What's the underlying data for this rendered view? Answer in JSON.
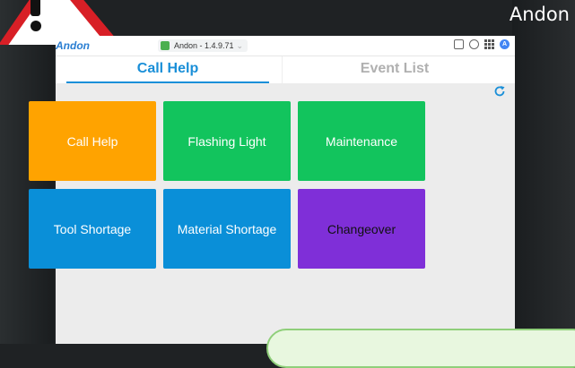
{
  "corner_title": "Andon",
  "app": {
    "brand": "Andon",
    "version_tab": "Andon - 1.4.9.71",
    "avatar_letter": "A"
  },
  "tabs": [
    {
      "label": "Call Help",
      "active": true
    },
    {
      "label": "Event List",
      "active": false
    }
  ],
  "tiles": [
    {
      "label": "Call Help",
      "color": "#ffa300"
    },
    {
      "label": "Flashing Light",
      "color": "#12c45d"
    },
    {
      "label": "Maintenance",
      "color": "#12c45d"
    },
    {
      "label": "Tool Shortage",
      "color": "#0a8fd8"
    },
    {
      "label": "Material Shortage",
      "color": "#0a8fd8"
    },
    {
      "label": "Changeover",
      "color": "#7f2fd8"
    }
  ],
  "colors": {
    "accent": "#1a8fd8",
    "inactive_tab": "#b0b0b0"
  },
  "icons": [
    "warning-icon",
    "document-icon",
    "globe-icon",
    "apps-grid-icon",
    "refresh-icon"
  ]
}
